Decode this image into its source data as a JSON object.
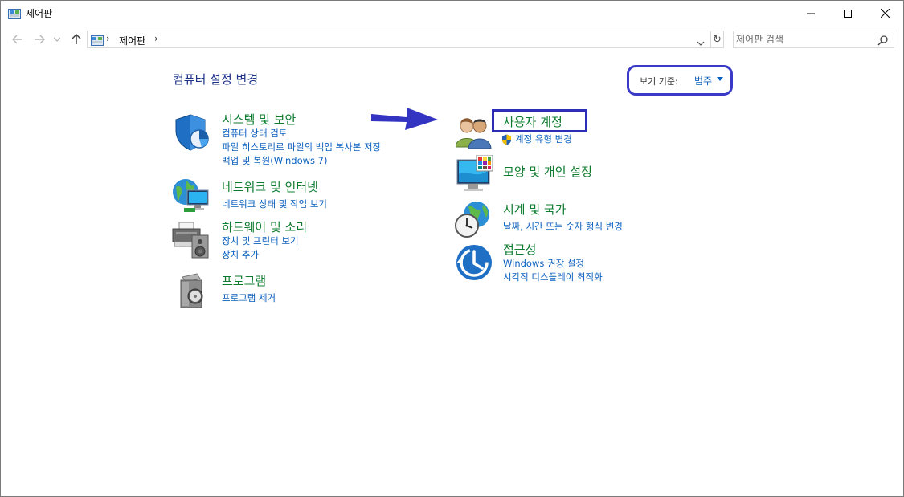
{
  "window": {
    "title": "제어판"
  },
  "address": {
    "path_item": "제어판",
    "search_placeholder": "제어판 검색"
  },
  "main": {
    "heading": "컴퓨터 설정 변경",
    "view_by_label": "보기 기준:",
    "view_by_value": "범주"
  },
  "categories_left": [
    {
      "title": "시스템 및 보안",
      "links": [
        "컴퓨터 상태 검토",
        "파일 히스토리로 파일의 백업 복사본 저장",
        "백업 및 복원(Windows 7)"
      ]
    },
    {
      "title": "네트워크 및 인터넷",
      "links": [
        "네트워크 상태 및 작업 보기"
      ]
    },
    {
      "title": "하드웨어 및 소리",
      "links": [
        "장치 및 프린터 보기",
        "장치 추가"
      ]
    },
    {
      "title": "프로그램",
      "links": [
        "프로그램 제거"
      ]
    }
  ],
  "categories_right": [
    {
      "title": "사용자 계정",
      "links": [
        "계정 유형 변경"
      ]
    },
    {
      "title": "모양 및 개인 설정",
      "links": []
    },
    {
      "title": "시계 및 국가",
      "links": [
        "날짜, 시간 또는 숫자 형식 변경"
      ]
    },
    {
      "title": "접근성",
      "links": [
        "Windows 권장 설정",
        "시각적 디스플레이 최적화"
      ]
    }
  ],
  "colors": {
    "link": "#0a5fbd",
    "category_title": "#0d7c2f",
    "heading": "#1e3287",
    "annotation": "#3a3ac8"
  }
}
